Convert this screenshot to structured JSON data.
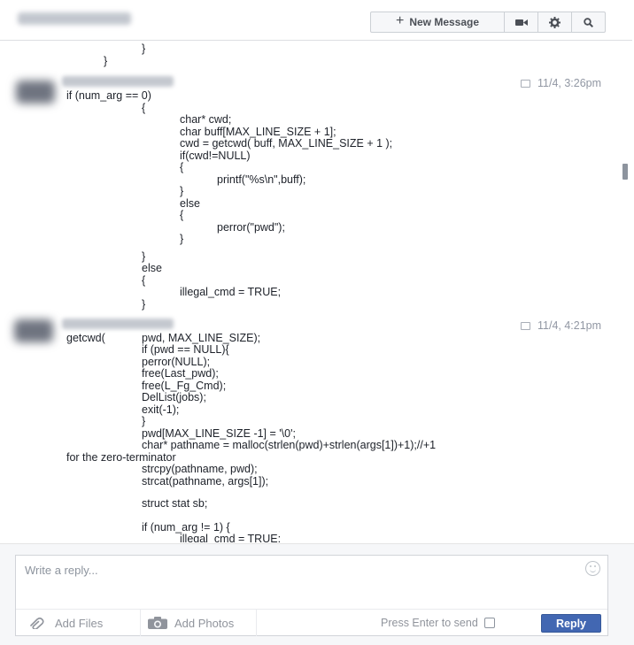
{
  "header": {
    "conversation_name": "Maxwell Wanek",
    "new_message_label": "New Message",
    "icons": [
      "plus-icon",
      "video-camera-icon",
      "gear-icon",
      "search-icon"
    ]
  },
  "thread": {
    "top_fragment": [
      "}",
      "}"
    ],
    "messages": [
      {
        "sender": "Maxwell Wanek",
        "timestamp": "11/4, 3:26pm",
        "code": [
          "if (num_arg == 0)",
          "{",
          "char* cwd;",
          "char buff[MAX_LINE_SIZE + 1];",
          "cwd = getcwd( buff, MAX_LINE_SIZE + 1 );",
          "if(cwd!=NULL)",
          "{",
          "printf(\"%s\\n\",buff);",
          "}",
          "else",
          "{",
          "perror(\"pwd\");",
          "}",
          "}",
          "else",
          "{",
          "illegal_cmd = TRUE;",
          "}"
        ]
      },
      {
        "sender": "Maxwell Wanek",
        "timestamp": "11/4, 4:21pm",
        "code": [
          "getcwd(",
          "pwd, MAX_LINE_SIZE);",
          "if (pwd == NULL){",
          "perror(NULL);",
          "free(Last_pwd);",
          "free(L_Fg_Cmd);",
          "DelList(jobs);",
          "exit(-1);",
          "}",
          "pwd[MAX_LINE_SIZE -1] = '\\0';",
          "char* pathname = malloc(strlen(pwd)+strlen(args[1])+1);//+1",
          "for the zero-terminator",
          "strcpy(pathname, pwd);",
          "strcat(pathname, args[1]);",
          "struct stat sb;",
          "if (num_arg != 1) {",
          "illegal_cmd = TRUE;"
        ]
      }
    ]
  },
  "composer": {
    "placeholder": "Write a reply...",
    "add_files_label": "Add Files",
    "add_photos_label": "Add Photos",
    "press_enter_label": "Press Enter to send",
    "press_enter_checked": false,
    "reply_label": "Reply",
    "accent_color": "#4267b2"
  }
}
